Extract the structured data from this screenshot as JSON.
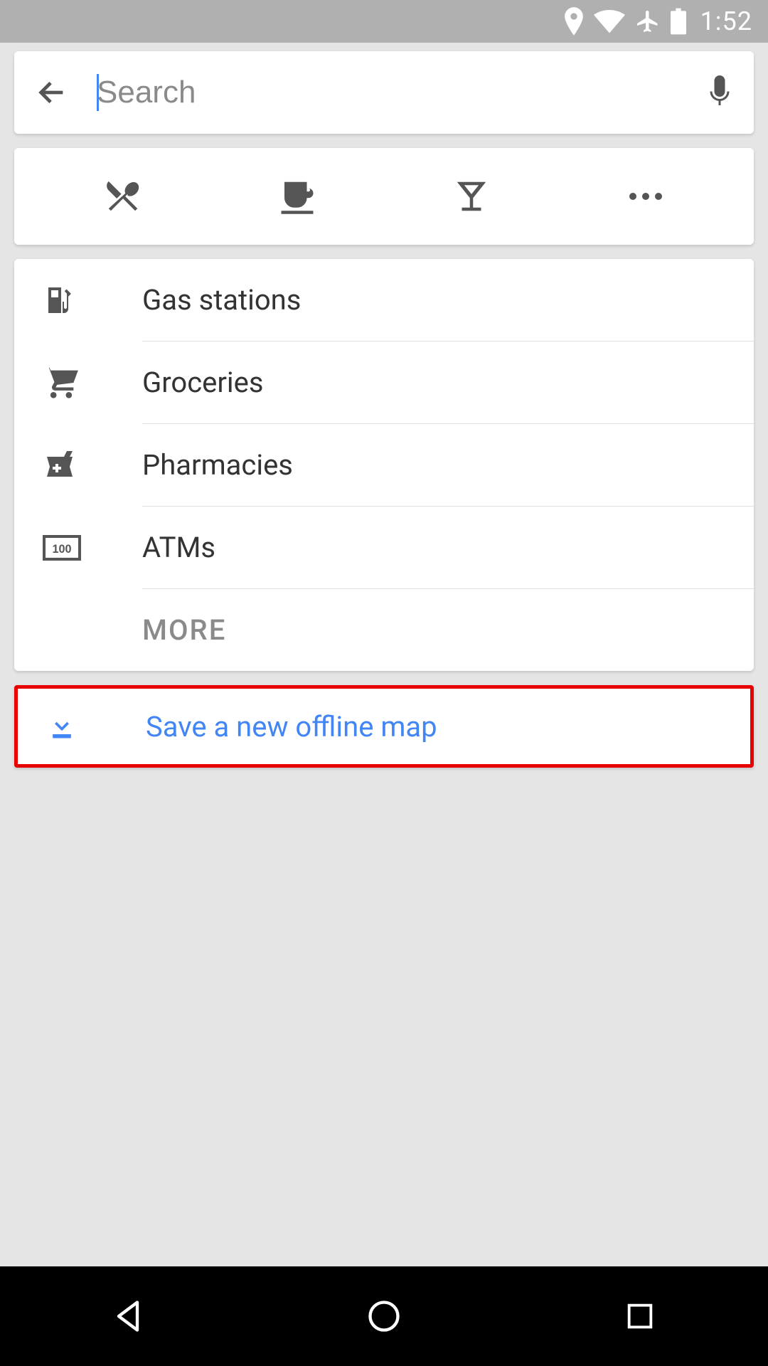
{
  "status": {
    "time": "1:52"
  },
  "search": {
    "placeholder": "Search",
    "value": ""
  },
  "categories": {
    "items": [
      {
        "icon": "gas-pump-icon",
        "label": "Gas stations"
      },
      {
        "icon": "cart-icon",
        "label": "Groceries"
      },
      {
        "icon": "pharmacy-icon",
        "label": "Pharmacies"
      },
      {
        "icon": "atm-icon",
        "label": "ATMs"
      }
    ],
    "more_label": "MORE"
  },
  "offline": {
    "label": "Save a new offline map"
  },
  "colors": {
    "accent": "#4285f4",
    "highlight_border": "#e60000"
  }
}
